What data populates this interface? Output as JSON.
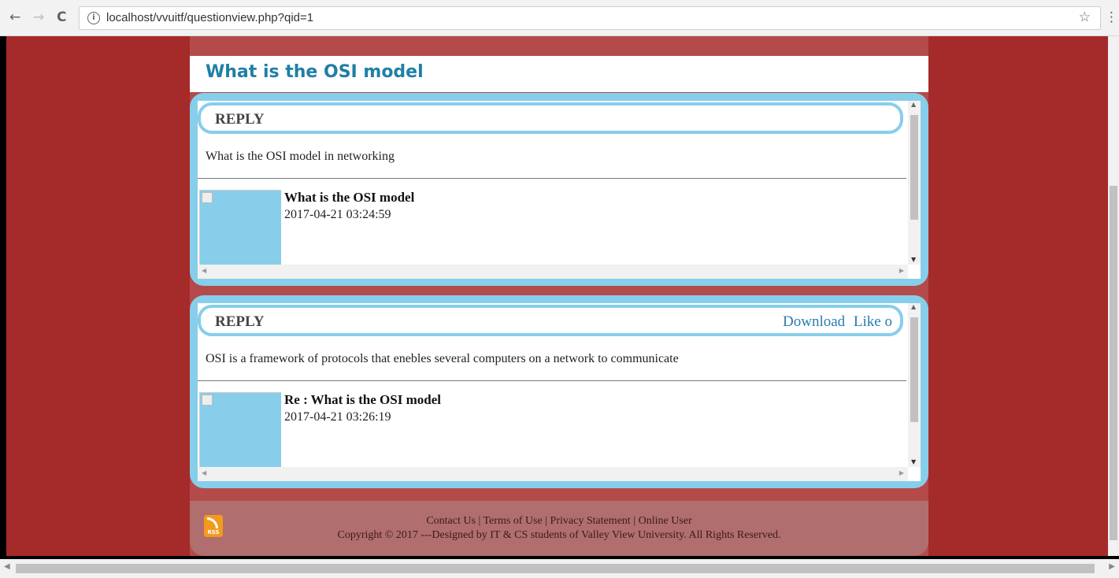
{
  "browser": {
    "url": "localhost/vvuitf/questionview.php?qid=1",
    "back_glyph": "←",
    "forward_glyph": "→",
    "reload_glyph": "C",
    "info_glyph": "i",
    "star_glyph": "☆",
    "menu_glyph": "⋮"
  },
  "page": {
    "title": "What is the OSI model"
  },
  "replies": [
    {
      "label": "REPLY",
      "actions": [],
      "body": "What is the OSI model in networking",
      "post_title": "What is the OSI model",
      "timestamp": "2017-04-21 03:24:59"
    },
    {
      "label": "REPLY",
      "actions": [
        "Download",
        "Like o"
      ],
      "body": "OSI is a framework of protocols that enebles several computers on a network to communicate",
      "post_title": "Re : What is the OSI model",
      "timestamp": "2017-04-21 03:26:19"
    }
  ],
  "footer": {
    "links": [
      "Contact Us",
      "Terms of Use",
      "Privacy Statement",
      "Online User"
    ],
    "separator": " | ",
    "copyright": "Copyright © 2017 ---Designed by IT & CS students of Valley View University. All Rights Reserved.",
    "rss_label": "RSS"
  },
  "colors": {
    "page_bg": "#a52a2a",
    "container_bg": "#b44a4a",
    "accent_blue": "#87ceeb",
    "title_color": "#1f7fa6",
    "link_color": "#2b7bb0"
  }
}
